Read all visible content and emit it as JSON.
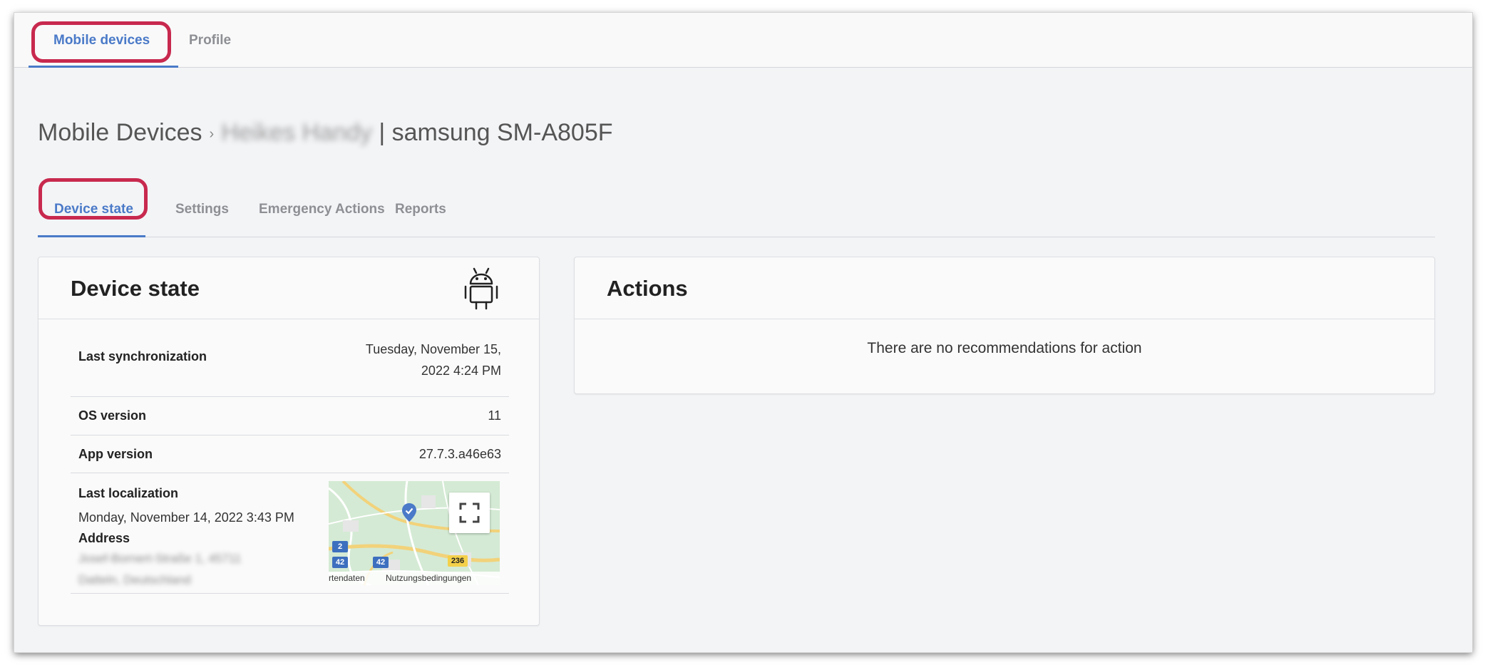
{
  "top_tabs": [
    {
      "label": "Mobile devices",
      "active": true
    },
    {
      "label": "Profile",
      "active": false
    }
  ],
  "breadcrumb": {
    "root": "Mobile Devices",
    "device_name_redacted": "Heikes Handy",
    "device_model": "| samsung SM-A805F"
  },
  "sub_tabs": [
    {
      "label": "Device state",
      "active": true
    },
    {
      "label": "Settings",
      "active": false
    },
    {
      "label": "Emergency Actions",
      "active": false
    },
    {
      "label": "Reports",
      "active": false
    }
  ],
  "device_state": {
    "title": "Device state",
    "os_icon": "android-icon",
    "rows": {
      "last_sync": {
        "label": "Last synchronization",
        "value_line1": "Tuesday, November 15,",
        "value_line2": "2022 4:24 PM"
      },
      "os_version": {
        "label": "OS version",
        "value": "11"
      },
      "app_version": {
        "label": "App version",
        "value": "27.7.3.a46e63"
      }
    },
    "localization": {
      "label": "Last localization",
      "date": "Monday, November 14, 2022 3:43 PM",
      "address_label": "Address",
      "address_line1": "Josef-Bornert-Straße 1, 45711",
      "address_line2": "Datteln, Deutschland",
      "map": {
        "fullscreen_icon": "fullscreen-icon",
        "marker_icon": "location-marker-icon",
        "footer_left": "rtendaten",
        "footer_right": "Nutzungsbedingungen",
        "road_badges": [
          "2",
          "42",
          "42",
          "236"
        ]
      }
    }
  },
  "actions": {
    "title": "Actions",
    "empty_message": "There are no recommendations for action"
  },
  "colors": {
    "accent": "#4a7ac8",
    "highlight": "#c8294e",
    "background": "#f3f4f6"
  }
}
